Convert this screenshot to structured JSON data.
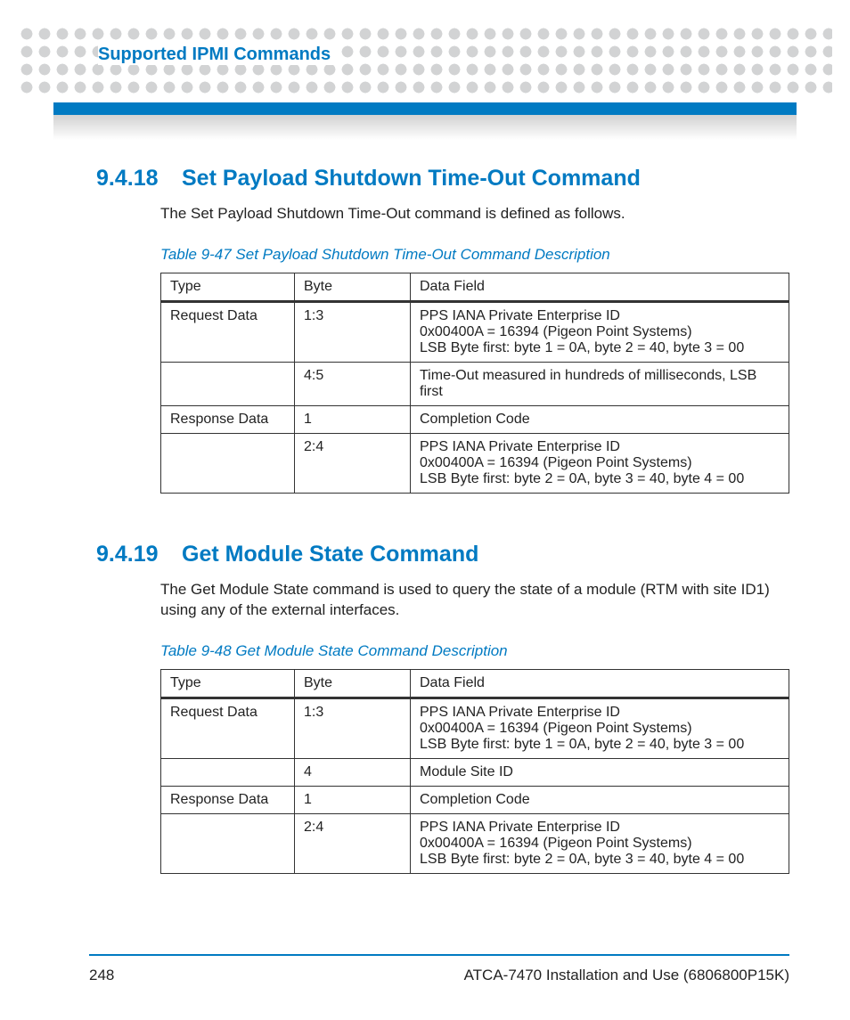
{
  "header": {
    "chapter_title": "Supported IPMI Commands"
  },
  "sections": [
    {
      "number": "9.4.18",
      "title": "Set Payload Shutdown Time-Out Command",
      "paragraph": "The Set Payload Shutdown Time-Out command is defined as follows.",
      "table_caption": "Table 9-47 Set Payload Shutdown Time-Out Command Description",
      "columns": [
        "Type",
        "Byte",
        "Data Field"
      ],
      "rows": [
        {
          "type": "Request Data",
          "byte": "1:3",
          "data": "PPS IANA Private Enterprise ID\n0x00400A = 16394 (Pigeon Point Systems)\nLSB Byte first: byte 1 = 0A, byte 2 = 40, byte 3 = 00"
        },
        {
          "type": "",
          "byte": "4:5",
          "data": "Time-Out measured in hundreds of milliseconds, LSB first"
        },
        {
          "type": "Response Data",
          "byte": "1",
          "data": "Completion Code"
        },
        {
          "type": "",
          "byte": "2:4",
          "data": "PPS IANA Private Enterprise ID\n0x00400A = 16394 (Pigeon Point Systems)\nLSB Byte first: byte 2 = 0A, byte 3 = 40, byte 4 = 00"
        }
      ]
    },
    {
      "number": "9.4.19",
      "title": "Get Module State Command",
      "paragraph": "The Get Module State command is used to query the state of a module (RTM with site ID1) using any of the external interfaces.",
      "table_caption": "Table 9-48 Get Module State Command Description",
      "columns": [
        "Type",
        "Byte",
        "Data Field"
      ],
      "rows": [
        {
          "type": "Request Data",
          "byte": "1:3",
          "data": "PPS IANA Private Enterprise ID\n0x00400A = 16394 (Pigeon Point Systems)\nLSB Byte first: byte 1 = 0A, byte 2 = 40, byte 3 = 00"
        },
        {
          "type": "",
          "byte": "4",
          "data": "Module Site ID"
        },
        {
          "type": "Response Data",
          "byte": "1",
          "data": "Completion Code"
        },
        {
          "type": "",
          "byte": "2:4",
          "data": "PPS IANA Private Enterprise ID\n0x00400A = 16394 (Pigeon Point Systems)\nLSB Byte first: byte 2 = 0A, byte 3 = 40, byte 4 = 00"
        }
      ]
    }
  ],
  "footer": {
    "page_number": "248",
    "doc_title": "ATCA-7470 Installation and Use (6806800P15K)"
  }
}
